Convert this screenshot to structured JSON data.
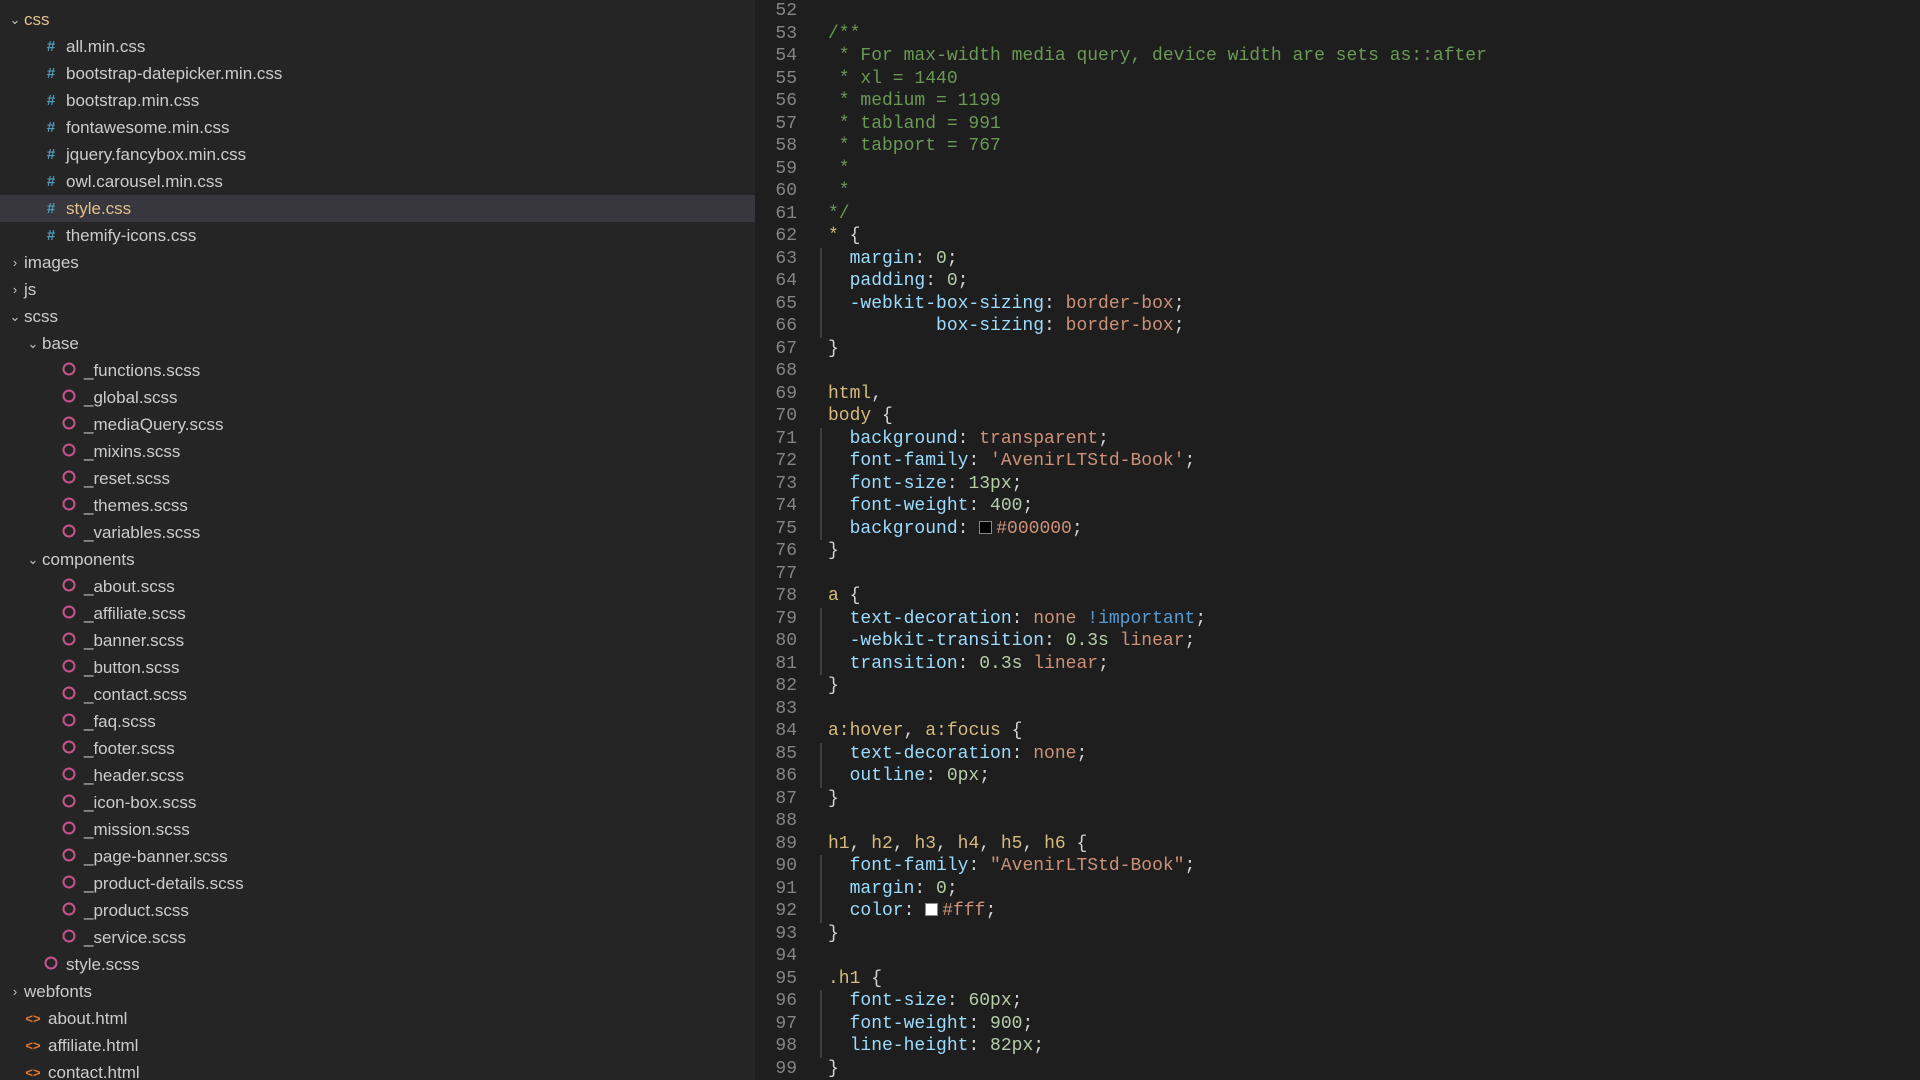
{
  "sidebar": {
    "tree": [
      {
        "depth": 0,
        "type": "folder",
        "state": "open",
        "name": "css",
        "highlight": true
      },
      {
        "depth": 1,
        "type": "file",
        "icon": "hash",
        "name": "all.min.css"
      },
      {
        "depth": 1,
        "type": "file",
        "icon": "hash",
        "name": "bootstrap-datepicker.min.css"
      },
      {
        "depth": 1,
        "type": "file",
        "icon": "hash",
        "name": "bootstrap.min.css"
      },
      {
        "depth": 1,
        "type": "file",
        "icon": "hash",
        "name": "fontawesome.min.css"
      },
      {
        "depth": 1,
        "type": "file",
        "icon": "hash",
        "name": "jquery.fancybox.min.css"
      },
      {
        "depth": 1,
        "type": "file",
        "icon": "hash",
        "name": "owl.carousel.min.css"
      },
      {
        "depth": 1,
        "type": "file",
        "icon": "hash",
        "name": "style.css",
        "selected": true
      },
      {
        "depth": 1,
        "type": "file",
        "icon": "hash",
        "name": "themify-icons.css"
      },
      {
        "depth": 0,
        "type": "folder",
        "state": "closed",
        "name": "images"
      },
      {
        "depth": 0,
        "type": "folder",
        "state": "closed",
        "name": "js"
      },
      {
        "depth": 0,
        "type": "folder",
        "state": "open",
        "name": "scss"
      },
      {
        "depth": 1,
        "type": "folder",
        "state": "open",
        "name": "base"
      },
      {
        "depth": 2,
        "type": "file",
        "icon": "scss",
        "name": "_functions.scss"
      },
      {
        "depth": 2,
        "type": "file",
        "icon": "scss",
        "name": "_global.scss"
      },
      {
        "depth": 2,
        "type": "file",
        "icon": "scss",
        "name": "_mediaQuery.scss"
      },
      {
        "depth": 2,
        "type": "file",
        "icon": "scss",
        "name": "_mixins.scss"
      },
      {
        "depth": 2,
        "type": "file",
        "icon": "scss",
        "name": "_reset.scss"
      },
      {
        "depth": 2,
        "type": "file",
        "icon": "scss",
        "name": "_themes.scss"
      },
      {
        "depth": 2,
        "type": "file",
        "icon": "scss",
        "name": "_variables.scss"
      },
      {
        "depth": 1,
        "type": "folder",
        "state": "open",
        "name": "components"
      },
      {
        "depth": 2,
        "type": "file",
        "icon": "scss",
        "name": "_about.scss"
      },
      {
        "depth": 2,
        "type": "file",
        "icon": "scss",
        "name": "_affiliate.scss"
      },
      {
        "depth": 2,
        "type": "file",
        "icon": "scss",
        "name": "_banner.scss"
      },
      {
        "depth": 2,
        "type": "file",
        "icon": "scss",
        "name": "_button.scss"
      },
      {
        "depth": 2,
        "type": "file",
        "icon": "scss",
        "name": "_contact.scss"
      },
      {
        "depth": 2,
        "type": "file",
        "icon": "scss",
        "name": "_faq.scss"
      },
      {
        "depth": 2,
        "type": "file",
        "icon": "scss",
        "name": "_footer.scss"
      },
      {
        "depth": 2,
        "type": "file",
        "icon": "scss",
        "name": "_header.scss"
      },
      {
        "depth": 2,
        "type": "file",
        "icon": "scss",
        "name": "_icon-box.scss"
      },
      {
        "depth": 2,
        "type": "file",
        "icon": "scss",
        "name": "_mission.scss"
      },
      {
        "depth": 2,
        "type": "file",
        "icon": "scss",
        "name": "_page-banner.scss"
      },
      {
        "depth": 2,
        "type": "file",
        "icon": "scss",
        "name": "_product-details.scss"
      },
      {
        "depth": 2,
        "type": "file",
        "icon": "scss",
        "name": "_product.scss"
      },
      {
        "depth": 2,
        "type": "file",
        "icon": "scss",
        "name": "_service.scss"
      },
      {
        "depth": 1,
        "type": "file",
        "icon": "scss",
        "name": "style.scss"
      },
      {
        "depth": 0,
        "type": "folder",
        "state": "closed",
        "name": "webfonts"
      },
      {
        "depth": 0,
        "type": "file",
        "icon": "html",
        "name": "about.html"
      },
      {
        "depth": 0,
        "type": "file",
        "icon": "html",
        "name": "affiliate.html"
      },
      {
        "depth": 0,
        "type": "file",
        "icon": "html",
        "name": "contact.html"
      }
    ]
  },
  "editor": {
    "first_line_number": 52,
    "lines": [
      {
        "n": 52,
        "tokens": []
      },
      {
        "n": 53,
        "tokens": [
          [
            "comment",
            "/**"
          ]
        ]
      },
      {
        "n": 54,
        "tokens": [
          [
            "comment",
            " * For max-width media query, device width are sets as::after"
          ]
        ]
      },
      {
        "n": 55,
        "tokens": [
          [
            "comment",
            " * xl = 1440"
          ]
        ]
      },
      {
        "n": 56,
        "tokens": [
          [
            "comment",
            " * medium = 1199"
          ]
        ]
      },
      {
        "n": 57,
        "tokens": [
          [
            "comment",
            " * tabland = 991"
          ]
        ]
      },
      {
        "n": 58,
        "tokens": [
          [
            "comment",
            " * tabport = 767"
          ]
        ]
      },
      {
        "n": 59,
        "tokens": [
          [
            "comment",
            " *"
          ]
        ]
      },
      {
        "n": 60,
        "tokens": [
          [
            "comment",
            " *"
          ]
        ]
      },
      {
        "n": 61,
        "tokens": [
          [
            "comment",
            "*/"
          ]
        ]
      },
      {
        "n": 62,
        "tokens": [
          [
            "sel",
            "*"
          ],
          [
            "punc",
            " {"
          ]
        ]
      },
      {
        "n": 63,
        "guide": true,
        "tokens": [
          [
            "prop",
            "  margin"
          ],
          [
            "punc",
            ": "
          ],
          [
            "num",
            "0"
          ],
          [
            "punc",
            ";"
          ]
        ]
      },
      {
        "n": 64,
        "guide": true,
        "tokens": [
          [
            "prop",
            "  padding"
          ],
          [
            "punc",
            ": "
          ],
          [
            "num",
            "0"
          ],
          [
            "punc",
            ";"
          ]
        ]
      },
      {
        "n": 65,
        "guide": true,
        "tokens": [
          [
            "prop",
            "  -webkit-box-sizing"
          ],
          [
            "punc",
            ": "
          ],
          [
            "val",
            "border-box"
          ],
          [
            "punc",
            ";"
          ]
        ]
      },
      {
        "n": 66,
        "guide": true,
        "tokens": [
          [
            "prop",
            "          box-sizing"
          ],
          [
            "punc",
            ": "
          ],
          [
            "val",
            "border-box"
          ],
          [
            "punc",
            ";"
          ]
        ]
      },
      {
        "n": 67,
        "tokens": [
          [
            "punc",
            "}"
          ]
        ]
      },
      {
        "n": 68,
        "tokens": []
      },
      {
        "n": 69,
        "tokens": [
          [
            "sel",
            "html"
          ],
          [
            "punc",
            ","
          ]
        ]
      },
      {
        "n": 70,
        "tokens": [
          [
            "sel",
            "body"
          ],
          [
            "punc",
            " {"
          ]
        ]
      },
      {
        "n": 71,
        "guide": true,
        "tokens": [
          [
            "prop",
            "  background"
          ],
          [
            "punc",
            ": "
          ],
          [
            "val",
            "transparent"
          ],
          [
            "punc",
            ";"
          ]
        ]
      },
      {
        "n": 72,
        "guide": true,
        "tokens": [
          [
            "prop",
            "  font-family"
          ],
          [
            "punc",
            ": "
          ],
          [
            "val",
            "'AvenirLTStd-Book'"
          ],
          [
            "punc",
            ";"
          ]
        ]
      },
      {
        "n": 73,
        "guide": true,
        "tokens": [
          [
            "prop",
            "  font-size"
          ],
          [
            "punc",
            ": "
          ],
          [
            "num",
            "13px"
          ],
          [
            "punc",
            ";"
          ]
        ]
      },
      {
        "n": 74,
        "guide": true,
        "tokens": [
          [
            "prop",
            "  font-weight"
          ],
          [
            "punc",
            ": "
          ],
          [
            "num",
            "400"
          ],
          [
            "punc",
            ";"
          ]
        ]
      },
      {
        "n": 75,
        "guide": true,
        "tokens": [
          [
            "prop",
            "  background"
          ],
          [
            "punc",
            ": "
          ],
          [
            "swatch",
            "#000000"
          ],
          [
            "val",
            "#000000"
          ],
          [
            "punc",
            ";"
          ]
        ]
      },
      {
        "n": 76,
        "tokens": [
          [
            "punc",
            "}"
          ]
        ]
      },
      {
        "n": 77,
        "tokens": []
      },
      {
        "n": 78,
        "tokens": [
          [
            "sel",
            "a"
          ],
          [
            "punc",
            " {"
          ]
        ]
      },
      {
        "n": 79,
        "guide": true,
        "tokens": [
          [
            "prop",
            "  text-decoration"
          ],
          [
            "punc",
            ": "
          ],
          [
            "val",
            "none"
          ],
          [
            "punc",
            " "
          ],
          [
            "imp",
            "!important"
          ],
          [
            "punc",
            ";"
          ]
        ]
      },
      {
        "n": 80,
        "guide": true,
        "tokens": [
          [
            "prop",
            "  -webkit-transition"
          ],
          [
            "punc",
            ": "
          ],
          [
            "num",
            "0.3s"
          ],
          [
            "punc",
            " "
          ],
          [
            "val",
            "linear"
          ],
          [
            "punc",
            ";"
          ]
        ]
      },
      {
        "n": 81,
        "guide": true,
        "tokens": [
          [
            "prop",
            "  transition"
          ],
          [
            "punc",
            ": "
          ],
          [
            "num",
            "0.3s"
          ],
          [
            "punc",
            " "
          ],
          [
            "val",
            "linear"
          ],
          [
            "punc",
            ";"
          ]
        ]
      },
      {
        "n": 82,
        "tokens": [
          [
            "punc",
            "}"
          ]
        ]
      },
      {
        "n": 83,
        "tokens": []
      },
      {
        "n": 84,
        "tokens": [
          [
            "sel",
            "a:hover"
          ],
          [
            "punc",
            ", "
          ],
          [
            "sel",
            "a:focus"
          ],
          [
            "punc",
            " {"
          ]
        ]
      },
      {
        "n": 85,
        "guide": true,
        "tokens": [
          [
            "prop",
            "  text-decoration"
          ],
          [
            "punc",
            ": "
          ],
          [
            "val",
            "none"
          ],
          [
            "punc",
            ";"
          ]
        ]
      },
      {
        "n": 86,
        "guide": true,
        "tokens": [
          [
            "prop",
            "  outline"
          ],
          [
            "punc",
            ": "
          ],
          [
            "num",
            "0px"
          ],
          [
            "punc",
            ";"
          ]
        ]
      },
      {
        "n": 87,
        "tokens": [
          [
            "punc",
            "}"
          ]
        ]
      },
      {
        "n": 88,
        "tokens": []
      },
      {
        "n": 89,
        "tokens": [
          [
            "sel",
            "h1"
          ],
          [
            "punc",
            ", "
          ],
          [
            "sel",
            "h2"
          ],
          [
            "punc",
            ", "
          ],
          [
            "sel",
            "h3"
          ],
          [
            "punc",
            ", "
          ],
          [
            "sel",
            "h4"
          ],
          [
            "punc",
            ", "
          ],
          [
            "sel",
            "h5"
          ],
          [
            "punc",
            ", "
          ],
          [
            "sel",
            "h6"
          ],
          [
            "punc",
            " {"
          ]
        ]
      },
      {
        "n": 90,
        "guide": true,
        "tokens": [
          [
            "prop",
            "  font-family"
          ],
          [
            "punc",
            ": "
          ],
          [
            "val",
            "\"AvenirLTStd-Book\""
          ],
          [
            "punc",
            ";"
          ]
        ]
      },
      {
        "n": 91,
        "guide": true,
        "tokens": [
          [
            "prop",
            "  margin"
          ],
          [
            "punc",
            ": "
          ],
          [
            "num",
            "0"
          ],
          [
            "punc",
            ";"
          ]
        ]
      },
      {
        "n": 92,
        "guide": true,
        "tokens": [
          [
            "prop",
            "  color"
          ],
          [
            "punc",
            ": "
          ],
          [
            "swatch",
            "#ffffff"
          ],
          [
            "val",
            "#fff"
          ],
          [
            "punc",
            ";"
          ]
        ]
      },
      {
        "n": 93,
        "tokens": [
          [
            "punc",
            "}"
          ]
        ]
      },
      {
        "n": 94,
        "tokens": []
      },
      {
        "n": 95,
        "tokens": [
          [
            "sel",
            ".h1"
          ],
          [
            "punc",
            " {"
          ]
        ]
      },
      {
        "n": 96,
        "guide": true,
        "tokens": [
          [
            "prop",
            "  font-size"
          ],
          [
            "punc",
            ": "
          ],
          [
            "num",
            "60px"
          ],
          [
            "punc",
            ";"
          ]
        ]
      },
      {
        "n": 97,
        "guide": true,
        "tokens": [
          [
            "prop",
            "  font-weight"
          ],
          [
            "punc",
            ": "
          ],
          [
            "num",
            "900"
          ],
          [
            "punc",
            ";"
          ]
        ]
      },
      {
        "n": 98,
        "guide": true,
        "tokens": [
          [
            "prop",
            "  line-height"
          ],
          [
            "punc",
            ": "
          ],
          [
            "num",
            "82px"
          ],
          [
            "punc",
            ";"
          ]
        ]
      },
      {
        "n": 99,
        "tokens": [
          [
            "punc",
            "}"
          ]
        ]
      }
    ]
  }
}
